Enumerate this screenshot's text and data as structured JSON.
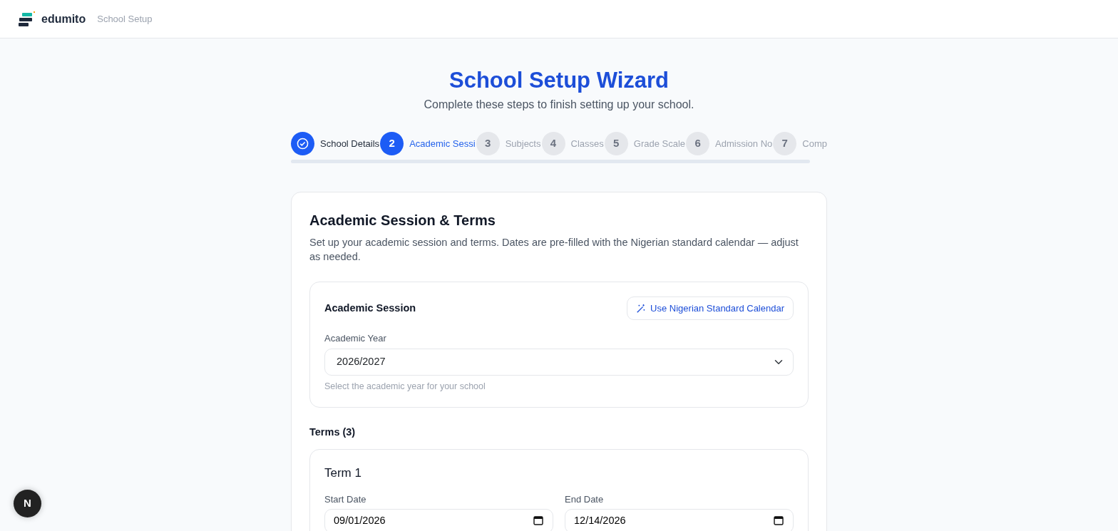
{
  "header": {
    "brand": "edumito",
    "section": "School Setup"
  },
  "wizard": {
    "title": "School Setup Wizard",
    "subtitle": "Complete these steps to finish setting up your school."
  },
  "steps": [
    {
      "label": "School Details",
      "completed": true,
      "selected": false
    },
    {
      "number": "2",
      "label": "Academic Sessi",
      "completed": false,
      "selected": true
    },
    {
      "number": "3",
      "label": "Subjects",
      "completed": false,
      "selected": false
    },
    {
      "number": "4",
      "label": "Classes",
      "completed": false,
      "selected": false
    },
    {
      "number": "5",
      "label": "Grade Scale",
      "completed": false,
      "selected": false
    },
    {
      "number": "6",
      "label": "Admission No",
      "completed": false,
      "selected": false
    },
    {
      "number": "7",
      "label": "Comp",
      "completed": false,
      "selected": false
    }
  ],
  "card": {
    "title": "Academic Session & Terms",
    "description": "Set up your academic session and terms. Dates are pre-filled with the Nigerian standard calendar — adjust as needed."
  },
  "session": {
    "title": "Academic Session",
    "button": "Use Nigerian Standard Calendar",
    "field_label": "Academic Year",
    "value": "2026/2027",
    "help": "Select the academic year for your school"
  },
  "terms_heading": "Terms (3)",
  "terms": [
    {
      "title": "Term 1",
      "start_label": "Start Date",
      "start_value": "09/01/2026",
      "end_label": "End Date",
      "end_value": "12/14/2026"
    }
  ],
  "dev_badge": "N"
}
